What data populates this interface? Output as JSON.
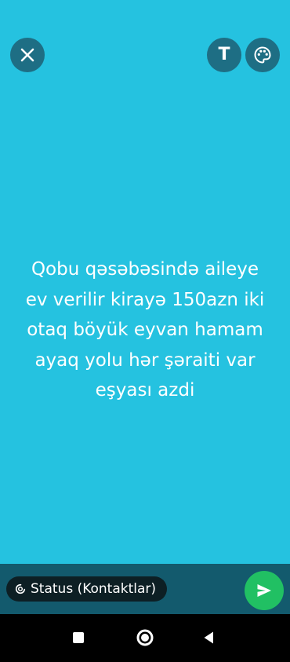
{
  "colors": {
    "canvas_background": "#25C2E0",
    "round_button": "#1E6E84",
    "bottom_bar": "#135A6D",
    "pill": "#0D1F24",
    "send_button": "#21C063",
    "nav_bar": "#000000"
  },
  "toolbar": {
    "close_icon": "close-icon",
    "text_button_label": "T",
    "palette_icon": "palette-icon"
  },
  "status": {
    "lines": [
      "Qobu qəsəbəsində aileye",
      "ev verilir kirayə 150azn iki",
      "otaq böyük eyvan hamam",
      "ayaq yolu hər şəraiti var",
      "eşyası azdi"
    ]
  },
  "composer": {
    "audience_label": "Status (Kontaktlar)",
    "audience_icon": "status-ring-icon",
    "send_icon": "send-icon"
  },
  "navigation": {
    "recents_icon": "square-icon",
    "home_icon": "circle-icon",
    "back_icon": "triangle-back-icon"
  }
}
